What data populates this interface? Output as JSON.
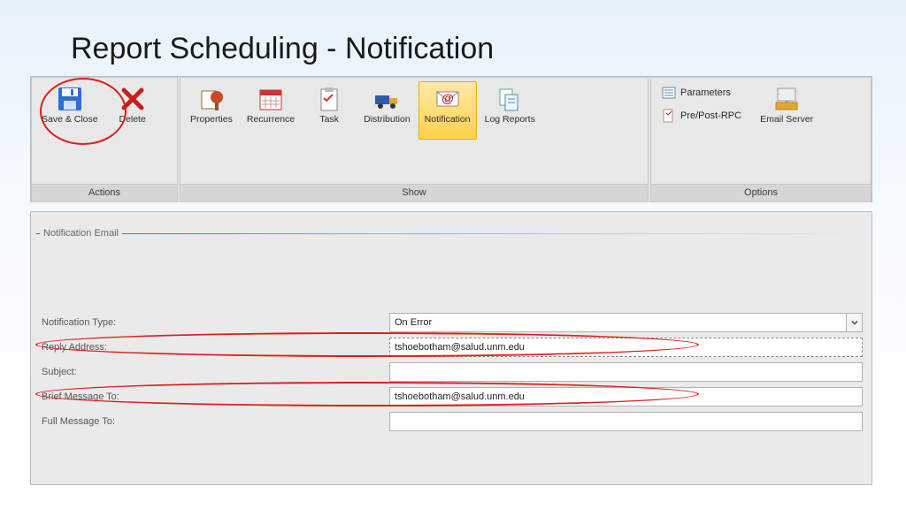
{
  "page_title": "Report Scheduling - Notification",
  "ribbon": {
    "groups": {
      "actions": {
        "label": "Actions",
        "save_close": "Save & Close",
        "delete": "Delete"
      },
      "show": {
        "label": "Show",
        "properties": "Properties",
        "recurrence": "Recurrence",
        "task": "Task",
        "distribution": "Distribution",
        "notification": "Notification",
        "log_reports": "Log Reports"
      },
      "options": {
        "label": "Options",
        "parameters": "Parameters",
        "pre_post_rpc": "Pre/Post-RPC",
        "email_server": "Email Server"
      }
    }
  },
  "panel": {
    "title": "Notification Email",
    "labels": {
      "notification_type": "Notification Type:",
      "reply_address": "Reply Address:",
      "subject": "Subject:",
      "brief_message_to": "Brief Message To:",
      "full_message_to": "Full Message To:"
    },
    "values": {
      "notification_type": "On Error",
      "reply_address": "tshoebotham@salud.unm.edu",
      "subject": "",
      "brief_message_to": "tshoebotham@salud.unm.edu",
      "full_message_to": ""
    }
  }
}
